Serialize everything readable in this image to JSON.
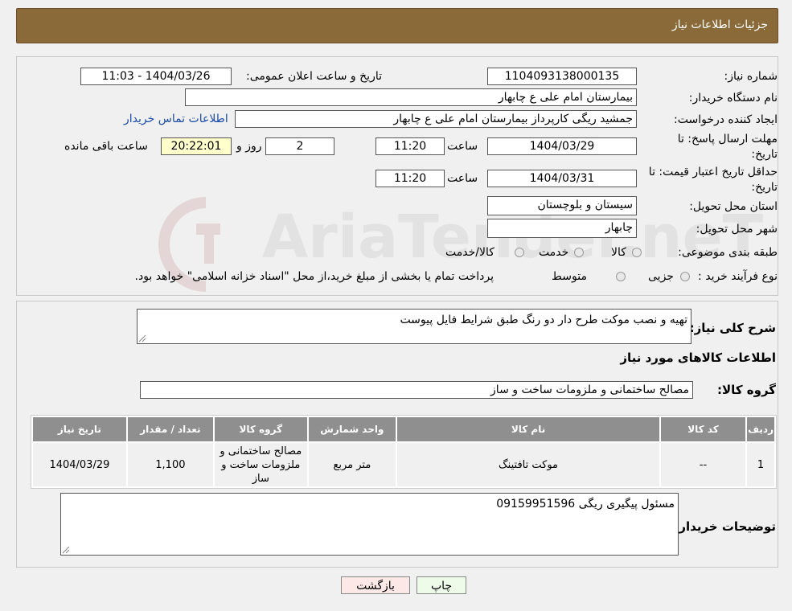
{
  "header": {
    "title": "جزئیات اطلاعات نیاز"
  },
  "watermark": "AriaTender.neT",
  "form": {
    "need_number": {
      "label": "شماره نیاز:",
      "value": "1104093138000135"
    },
    "announce_datetime": {
      "label": "تاریخ و ساعت اعلان عمومی:",
      "value": "1404/03/26 - 11:03"
    },
    "buyer_org": {
      "label": "نام دستگاه خریدار:",
      "value": "بیمارستان امام علی  ع  چابهار"
    },
    "requester": {
      "label": "ایجاد کننده درخواست:",
      "value": "جمشید ریگی کارپرداز بیمارستان امام علی  ع  چابهار",
      "contact_link": "اطلاعات تماس خریدار"
    },
    "reply_deadline": {
      "label_line1": "مهلت ارسال پاسخ: تا",
      "label_line2": "تاریخ:",
      "date": "1404/03/29",
      "time_label": "ساعت",
      "time": "11:20",
      "days": "2",
      "days_label": "روز و",
      "remaining_time": "20:22:01",
      "remaining_label": "ساعت باقی مانده"
    },
    "price_validity": {
      "label_line1": "حداقل تاریخ اعتبار قیمت: تا",
      "label_line2": "تاریخ:",
      "date": "1404/03/31",
      "time_label": "ساعت",
      "time": "11:20"
    },
    "province": {
      "label": "استان محل تحویل:",
      "value": "سیستان و بلوچستان"
    },
    "city": {
      "label": "شهر محل تحویل:",
      "value": "چابهار"
    },
    "category": {
      "label": "طبقه بندی موضوعی:",
      "options": [
        "کالا",
        "خدمت",
        "کالا/خدمت"
      ]
    },
    "purchase_process": {
      "label": "نوع فرآیند خرید :",
      "options": [
        "جزیی",
        "متوسط"
      ],
      "note": "پرداخت تمام یا بخشی از مبلغ خرید،از محل \"اسناد خزانه اسلامی\" خواهد بود."
    }
  },
  "details": {
    "description_label": "شرح کلی نیاز:",
    "description": "تهیه و نصب موکت طرح دار دو رنگ طبق شرایط فایل پیوست",
    "goods_info_title": "اطلاعات کالاهای مورد نیاز",
    "goods_group_label": "گروه کالا:",
    "goods_group": "مصالح ساختمانی و ملزومات ساخت و ساز"
  },
  "table": {
    "headers": [
      "ردیف",
      "کد کالا",
      "نام کالا",
      "واحد شمارش",
      "گروه کالا",
      "تعداد / مقدار",
      "تاریخ نیاز"
    ],
    "rows": [
      [
        "1",
        "--",
        "موکت تافتینگ",
        "متر مربع",
        "مصالح ساختمانی و ملزومات ساخت و ساز",
        "1,100",
        "1404/03/29"
      ]
    ]
  },
  "buyer_notes": {
    "label": "توضیحات خریدار:",
    "value": "مسئول پیگیری ریگی 09159951596"
  },
  "buttons": {
    "print": "چاپ",
    "back": "بازگشت"
  },
  "colors": {
    "header_bg": "#8b6a3a",
    "table_header_bg": "#8f8f8f",
    "time_box_bg": "#ffffcc",
    "back_button_bg": "#fde8e8",
    "print_button_bg": "#eefbe8",
    "link": "#1a4aa8"
  }
}
